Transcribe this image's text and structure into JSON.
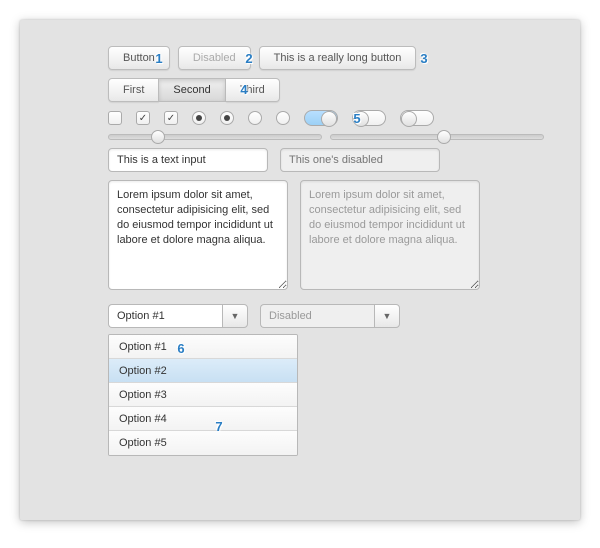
{
  "buttons_row1": {
    "button": "Button",
    "disabled": "Disabled",
    "long": "This is a really long button"
  },
  "segmented": {
    "first": "First",
    "second": "Second",
    "third": "Third"
  },
  "slider1_pos": "20%",
  "slider2_pos": "50%",
  "text_input": {
    "value": "This is a text input",
    "disabled_placeholder": "This one's disabled"
  },
  "textarea": {
    "value": "Lorem ipsum dolor sit amet, consectetur adipisicing elit, sed do eiusmod tempor incididunt ut labore et dolore magna aliqua.",
    "disabled_value": "Lorem ipsum dolor sit amet, consectetur adipisicing elit, sed do eiusmod tempor incididunt ut labore et dolore magna aliqua."
  },
  "select": {
    "value": "Option #1",
    "disabled_value": "Disabled"
  },
  "listbox": {
    "items": [
      "Option #1",
      "Option #2",
      "Option #3",
      "Option #4",
      "Option #5"
    ],
    "selected": 1
  },
  "markers": [
    "1",
    "2",
    "3",
    "4",
    "5",
    "6",
    "7"
  ]
}
